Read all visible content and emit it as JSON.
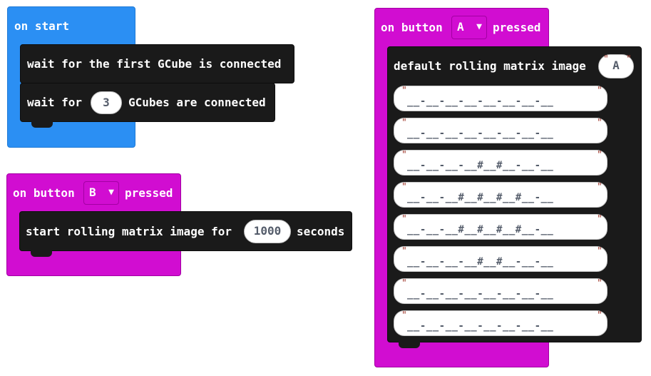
{
  "colors": {
    "on_start": "#2b8ff3",
    "button_event": "#d10dd1",
    "block": "#1a1a1a"
  },
  "on_start": {
    "label": "on start",
    "wait_first": "wait for the first GCube is connected",
    "wait_n_prefix": "wait for",
    "wait_n_value": "3",
    "wait_n_suffix": "GCubes are connected"
  },
  "on_button_b": {
    "prefix": "on button",
    "button": "B",
    "suffix": "pressed",
    "action_prefix": "start rolling matrix image for",
    "action_value": "1000",
    "action_suffix": "seconds"
  },
  "on_button_a": {
    "prefix": "on button",
    "button": "A",
    "suffix": "pressed",
    "default_label": "default rolling matrix image",
    "default_value": "A",
    "rows": [
      "__-__-__-__-__-__-__-__",
      "__-__-__-__-__-__-__-__",
      "__-__-__-__#__#__-__-__",
      "__-__-__#__#__#__#__-__",
      "__-__-__#__#__#__#__-__",
      "__-__-__-__#__#__-__-__",
      "__-__-__-__-__-__-__-__",
      "__-__-__-__-__-__-__-__"
    ]
  }
}
